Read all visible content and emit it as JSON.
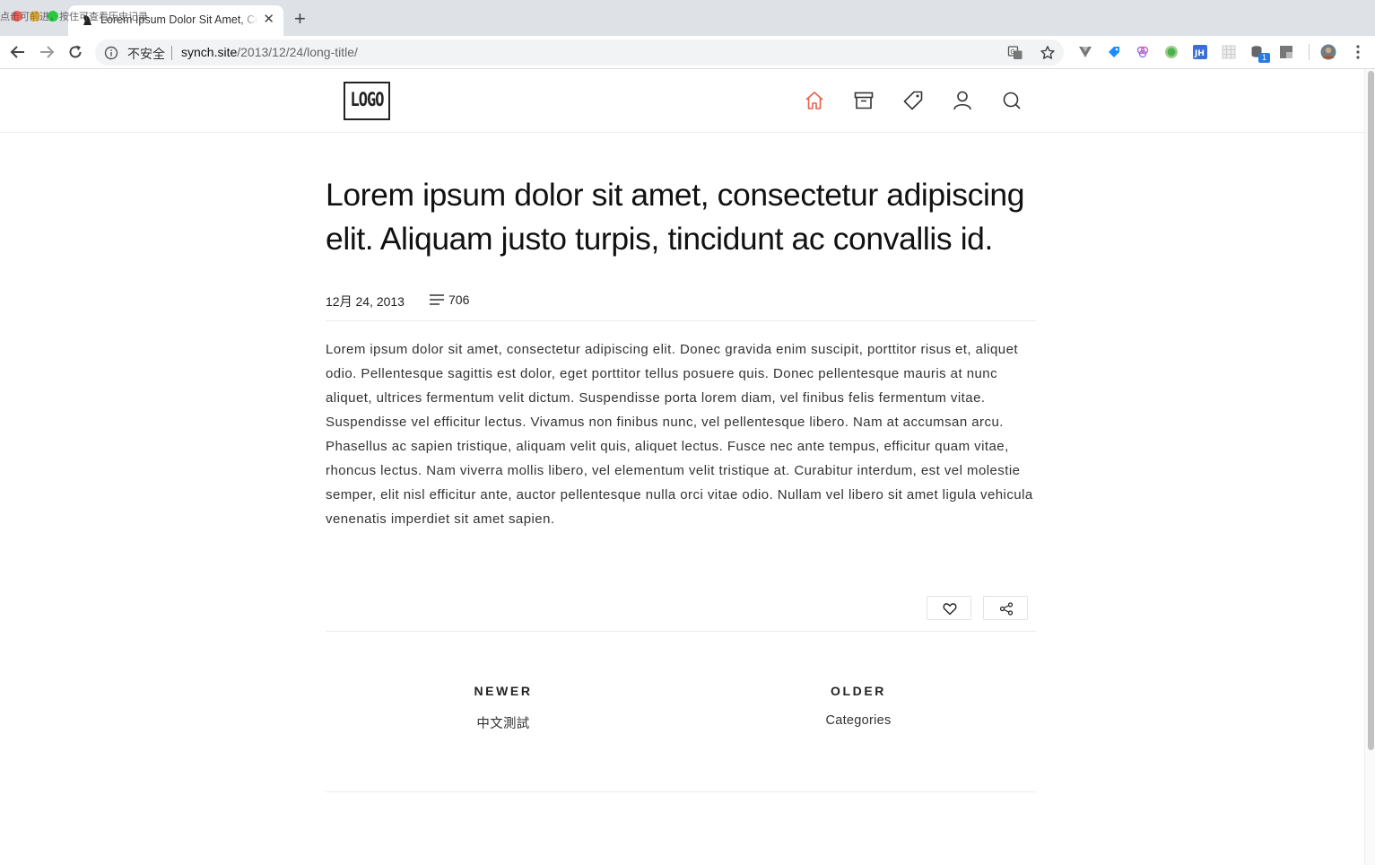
{
  "browser": {
    "tab_title": "Lorem Ipsum Dolor Sit Amet, Consectetur Adipiscing Elit",
    "tooltip": "点击可前进，按住可查看历史记录",
    "security_label": "不安全",
    "url_host": "synch.site",
    "url_path": "/2013/12/24/long-title/",
    "extension_badge": "1",
    "accent_color": "#e8604c"
  },
  "header": {
    "logo_text": "LOGO",
    "nav": [
      {
        "name": "home",
        "active": true
      },
      {
        "name": "archive"
      },
      {
        "name": "tags"
      },
      {
        "name": "about"
      },
      {
        "name": "search"
      }
    ]
  },
  "post": {
    "title": "Lorem ipsum dolor sit amet, consectetur adipiscing elit. Aliquam justo turpis, tincidunt ac convallis id.",
    "date": "12月 24, 2013",
    "word_count": "706",
    "body": "Lorem ipsum dolor sit amet, consectetur adipiscing elit. Donec gravida enim suscipit, porttitor risus et, aliquet odio. Pellentesque sagittis est dolor, eget porttitor tellus posuere quis. Donec pellentesque mauris at nunc aliquet, ultrices fermentum velit dictum. Suspendisse porta lorem diam, vel finibus felis fermentum vitae. Suspendisse vel efficitur lectus. Vivamus non finibus nunc, vel pellentesque libero. Nam at accumsan arcu. Phasellus ac sapien tristique, aliquam velit quis, aliquet lectus. Fusce nec ante tempus, efficitur quam vitae, rhoncus lectus. Nam viverra mollis libero, vel elementum velit tristique at. Curabitur interdum, est vel molestie semper, elit nisl efficitur ante, auctor pellentesque nulla orci vitae odio. Nullam vel libero sit amet ligula vehicula venenatis imperdiet sit amet sapien."
  },
  "post_nav": {
    "newer_heading": "NEWER",
    "newer_link": "中文測試",
    "older_heading": "OLDER",
    "older_link": "Categories"
  }
}
